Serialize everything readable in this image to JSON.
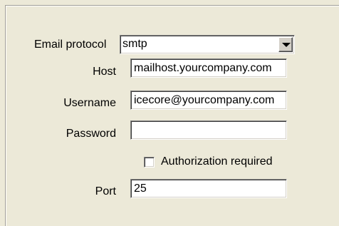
{
  "form": {
    "email_protocol": {
      "label": "Email protocol",
      "value": "smtp"
    },
    "host": {
      "label": "Host",
      "value": "mailhost.yourcompany.com"
    },
    "username": {
      "label": "Username",
      "value": "icecore@yourcompany.com"
    },
    "password": {
      "label": "Password",
      "value": ""
    },
    "authorization": {
      "label": "Authorization required",
      "checked": false
    },
    "port": {
      "label": "Port",
      "value": "25"
    }
  }
}
